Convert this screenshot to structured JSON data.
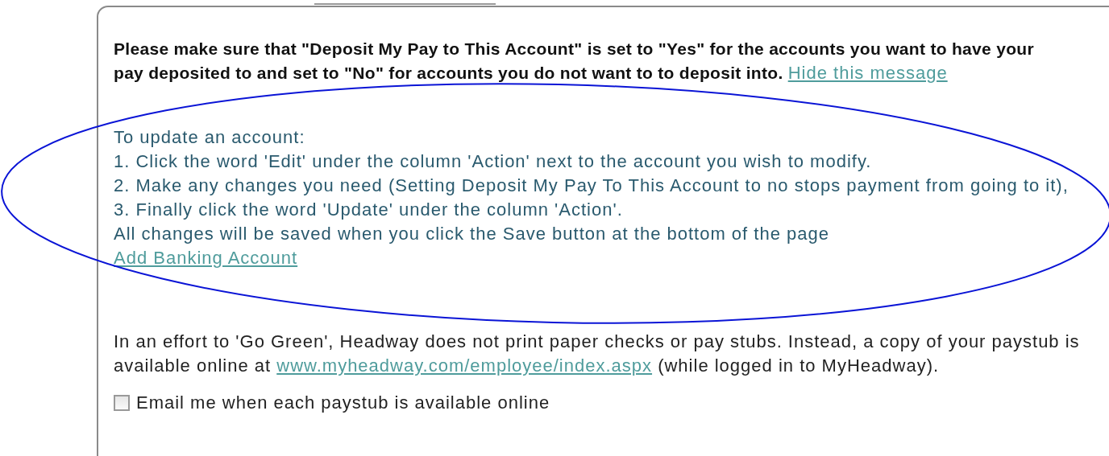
{
  "message": {
    "text": "Please make sure that \"Deposit My Pay to This Account\" is set to \"Yes\" for the accounts you want to have your pay deposited to and set to \"No\" for accounts you do not want to to deposit into.",
    "link": "Hide this message"
  },
  "instructions": {
    "heading": "To update an account:",
    "lines": [
      "1. Click the word 'Edit' under the column 'Action' next to the account you wish to modify.",
      "2. Make any changes you need (Setting Deposit My Pay To This Account to no stops payment from going to it),",
      "3. Finally click the word 'Update' under the column 'Action'.",
      "All changes will be saved when you click the Save button at the bottom of the page"
    ],
    "link": "Add Banking Account"
  },
  "note": {
    "before": "In an effort to 'Go Green', Headway does not print paper checks or pay stubs. Instead, a copy of your paystub is available online at",
    "link": "www.myheadway.com/employee/index.aspx",
    "after": "(while logged in to MyHeadway)."
  },
  "checkbox": {
    "label": "Email me when each paystub is available online",
    "checked": false
  }
}
